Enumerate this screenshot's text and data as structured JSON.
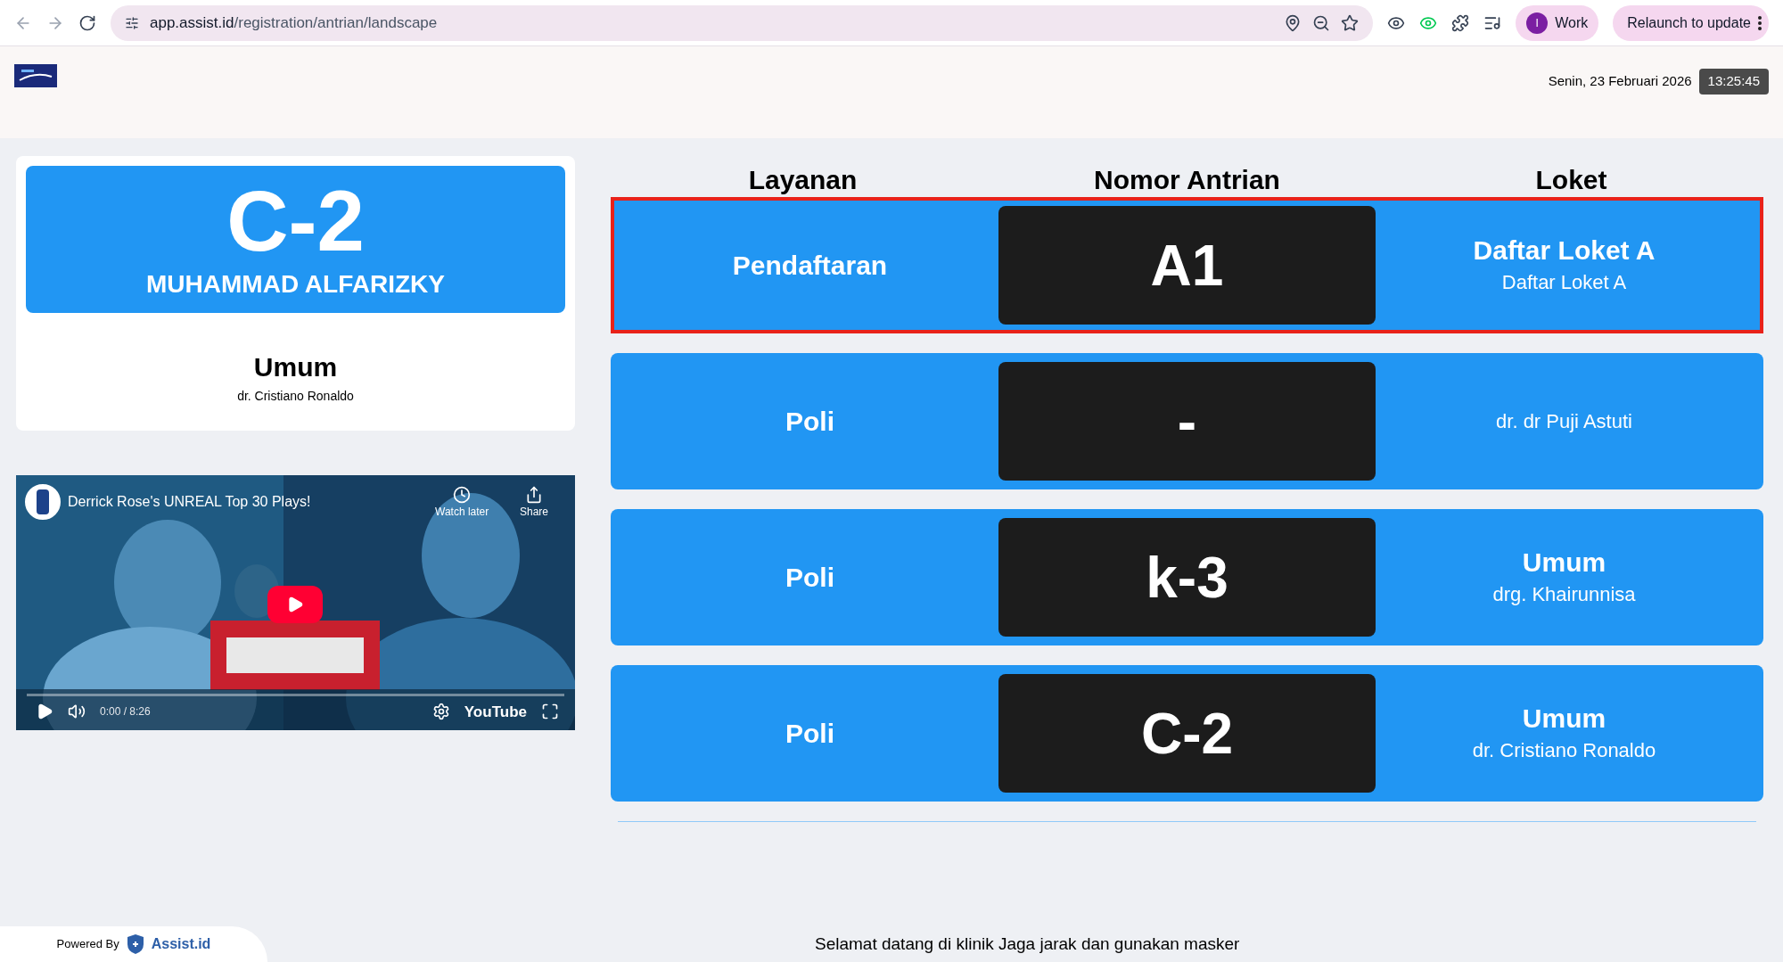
{
  "browser": {
    "url_host": "app.assist.id",
    "url_path": "/registration/antrian/landscape",
    "profile": "Work",
    "profile_initial": "I",
    "update_button": "Relaunch to update"
  },
  "header": {
    "date": "Senin, 23 Februari 2026",
    "time": "13:25:45"
  },
  "current_call": {
    "number": "C-2",
    "patient": "MUHAMMAD ALFARIZKY",
    "service": "Umum",
    "doctor": "dr. Cristiano Ronaldo"
  },
  "video": {
    "title": "Derrick Rose's UNREAL Top 30 Plays!",
    "watch_later": "Watch later",
    "share": "Share",
    "time": "0:00 / 8:26",
    "brand": "YouTube"
  },
  "table": {
    "columns": [
      "Layanan",
      "Nomor Antrian",
      "Loket"
    ],
    "rows": [
      {
        "service": "Pendaftaran",
        "number": "A1",
        "counter": "Daftar Loket A",
        "counter_sub": "Daftar Loket A",
        "selected": true
      },
      {
        "service": "Poli",
        "number": "-",
        "counter_sub": "dr. dr Puji Astuti",
        "selected": false
      },
      {
        "service": "Poli",
        "number": "k-3",
        "counter": "Umum",
        "counter_sub": "drg. Khairunnisa",
        "selected": false
      },
      {
        "service": "Poli",
        "number": "C-2",
        "counter": "Umum",
        "counter_sub": "dr. Cristiano Ronaldo",
        "selected": false
      }
    ]
  },
  "footer": {
    "powered_by": "Powered By",
    "brand": "Assist.id",
    "marquee": "Selamat datang di klinik Jaga jarak dan gunakan masker"
  }
}
